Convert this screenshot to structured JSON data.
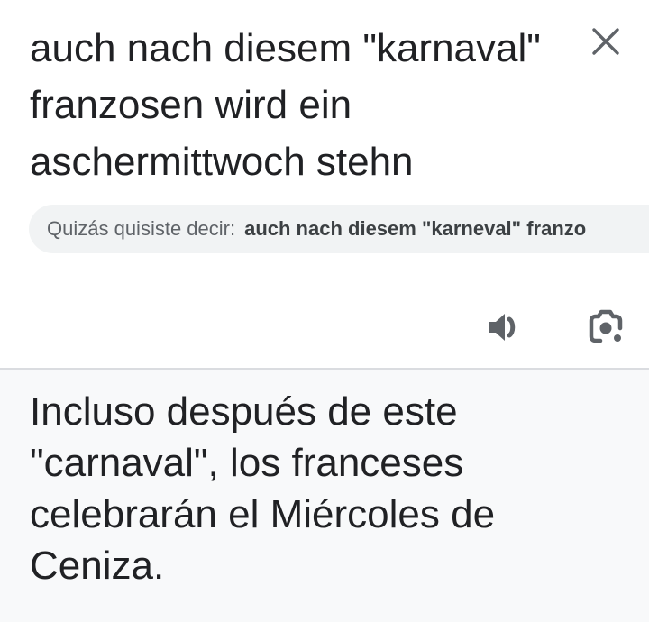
{
  "source": {
    "text": "auch nach diesem \"karnaval\" franzosen wird ein aschermittwoch stehn"
  },
  "suggestion": {
    "prefix": "Quizás quisiste decir:",
    "text": "auch nach diesem \"karneval\" franzo"
  },
  "translation": {
    "text": "Incluso después de este \"carnaval\", los franceses celebrarán el Miércoles de Ceniza."
  },
  "icons": {
    "close": "close-icon",
    "speaker": "volume-icon",
    "lens": "camera-lens-icon"
  },
  "colors": {
    "text": "#202124",
    "icon": "#5f6368",
    "chip_background": "#f1f3f4",
    "result_background": "#f8f9fa",
    "divider": "#dadce0"
  }
}
